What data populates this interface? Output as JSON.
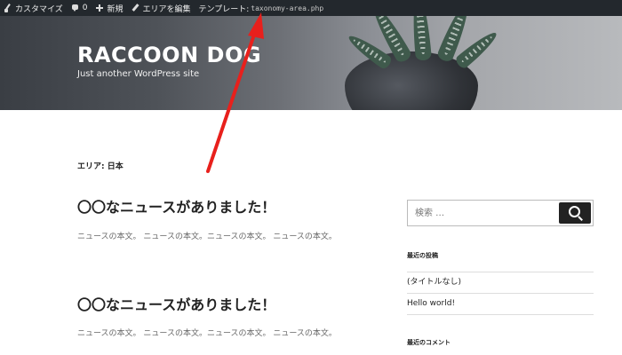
{
  "adminbar": {
    "customize": "カスタマイズ",
    "comments_count": "0",
    "new": "新規",
    "edit_area": "エリアを編集",
    "template_label": "テンプレート:",
    "template_file": "taxonomy-area.php"
  },
  "header": {
    "site_title": "RACCOON DOG",
    "site_description": "Just another WordPress site"
  },
  "main": {
    "archive_title": "エリア: 日本",
    "posts": [
      {
        "title": "〇〇なニュースがありました！",
        "body": "ニュースの本文。 ニュースの本文。ニュースの本文。 ニュースの本文。"
      },
      {
        "title": "〇〇なニュースがありました！",
        "body": "ニュースの本文。 ニュースの本文。ニュースの本文。 ニュースの本文。"
      }
    ]
  },
  "sidebar": {
    "search_placeholder": "検索 …",
    "recent_posts_title": "最近の投稿",
    "recent_posts": [
      "(タイトルなし)",
      "Hello world!"
    ],
    "recent_comments_title": "最近のコメント"
  },
  "colors": {
    "adminbar_bg": "#23282d",
    "annotation_arrow": "#e8201c"
  }
}
